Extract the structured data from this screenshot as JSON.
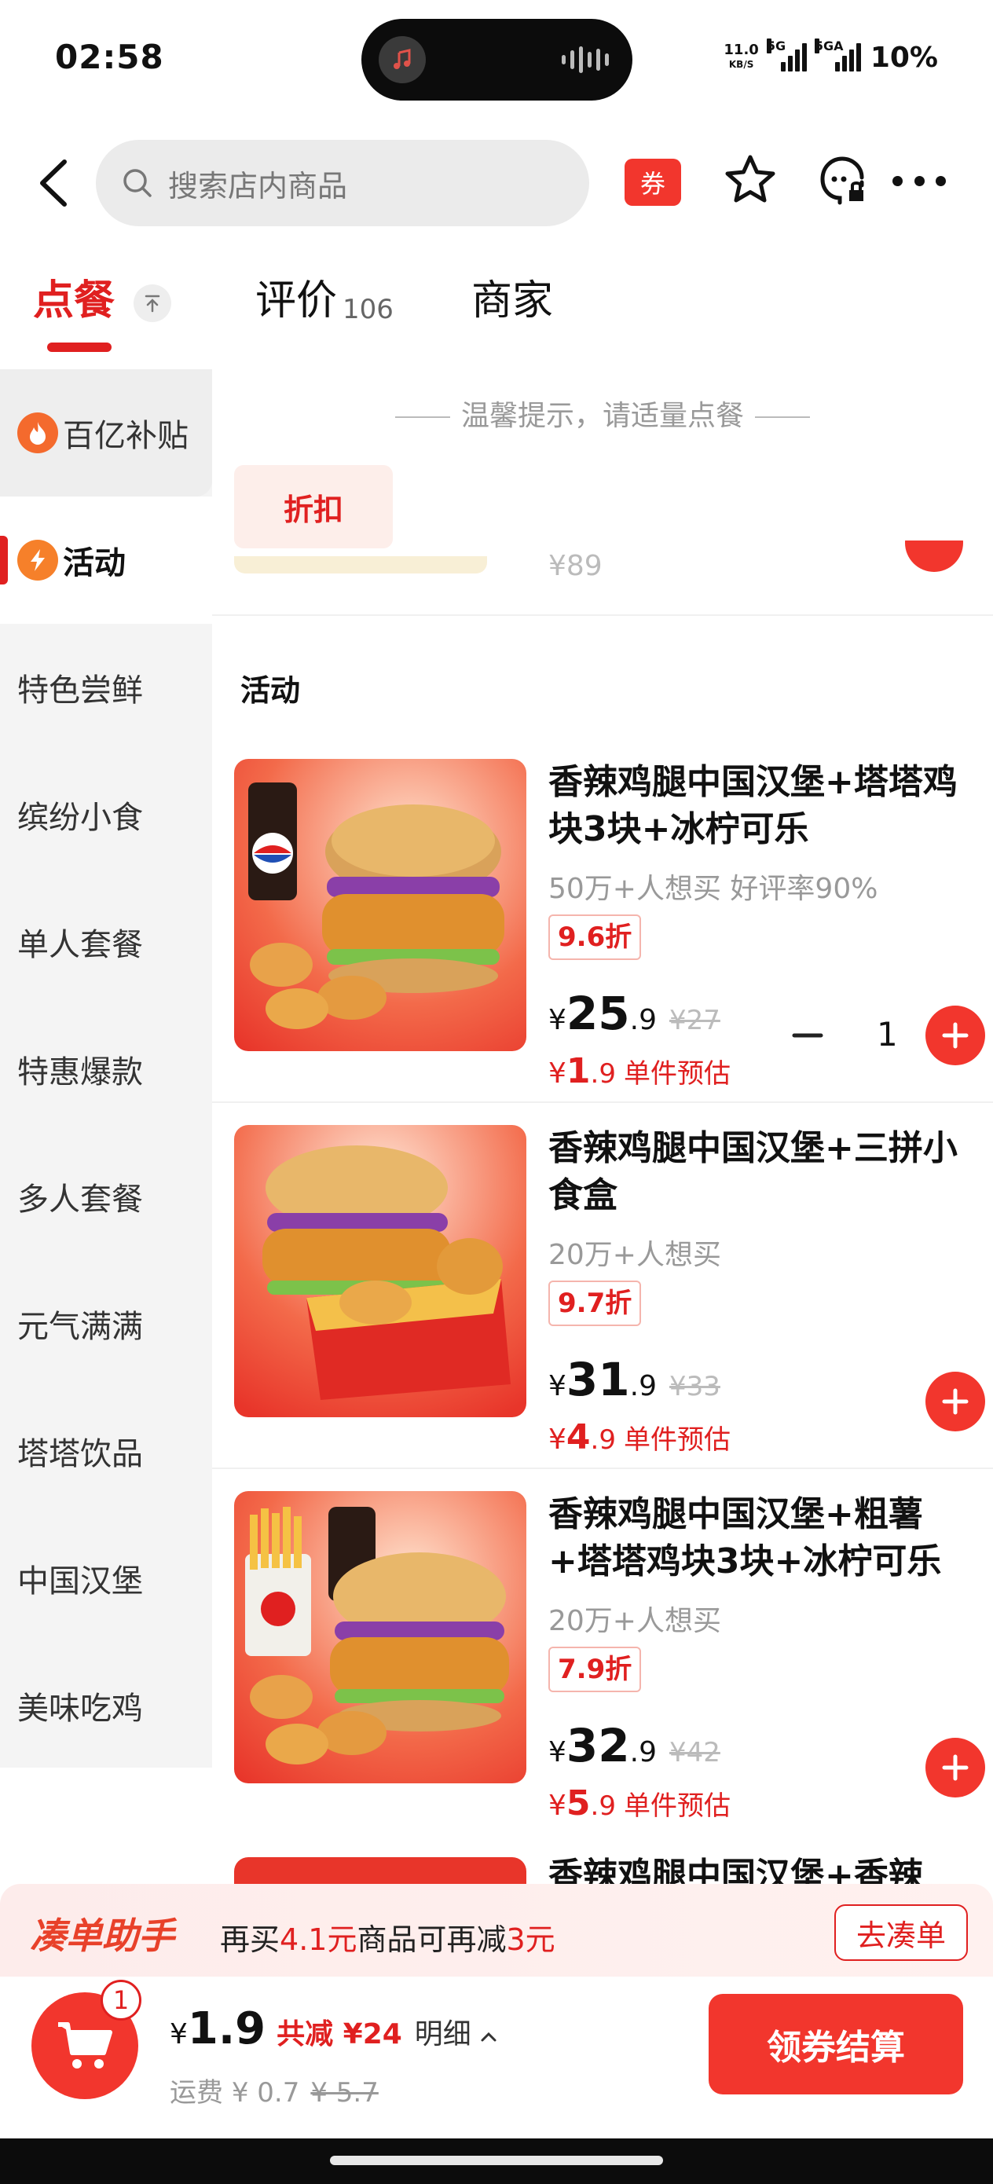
{
  "status_bar": {
    "time": "02:58",
    "net_speed_value": "11.0",
    "net_speed_unit": "KB/S",
    "signal1_label": "5G",
    "signal2_label": "5GA",
    "battery": "10%"
  },
  "header": {
    "search_placeholder": "搜索店内商品",
    "coupon_label": "券"
  },
  "tabs": {
    "order": "点餐",
    "review": "评价",
    "review_count": "106",
    "merchant": "商家"
  },
  "sidebar": {
    "items": [
      {
        "label": "百亿补贴",
        "icon": "flame-icon"
      },
      {
        "label": "活动",
        "icon": "lightning-icon"
      },
      {
        "label": "特色尝鲜"
      },
      {
        "label": "缤纷小食"
      },
      {
        "label": "单人套餐"
      },
      {
        "label": "特惠爆款"
      },
      {
        "label": "多人套餐"
      },
      {
        "label": "元气满满"
      },
      {
        "label": "塔塔饮品"
      },
      {
        "label": "中国汉堡"
      },
      {
        "label": "美味吃鸡"
      }
    ]
  },
  "content": {
    "notice": "温馨提示，请适量点餐",
    "discount_chip": "折扣",
    "prev_price": "¥89",
    "section_title": "活动",
    "products": [
      {
        "name": "香辣鸡腿中国汉堡+塔塔鸡块3块+冰柠可乐",
        "sales": "50万+人想买 好评率90%",
        "discount": "9.6折",
        "price_yen": "¥",
        "price_int": "25",
        "price_dec": ".9",
        "orig_price": "¥27",
        "est_yen": "¥",
        "est_int": "1",
        "est_dec": ".9",
        "est_label": "单件预估",
        "quantity": "1"
      },
      {
        "name": "香辣鸡腿中国汉堡+三拼小食盒",
        "sales": "20万+人想买",
        "discount": "9.7折",
        "price_yen": "¥",
        "price_int": "31",
        "price_dec": ".9",
        "orig_price": "¥33",
        "est_yen": "¥",
        "est_int": "4",
        "est_dec": ".9",
        "est_label": "单件预估"
      },
      {
        "name": "香辣鸡腿中国汉堡+粗薯+塔塔鸡块3块+冰柠可乐",
        "sales": "20万+人想买",
        "discount": "7.9折",
        "price_yen": "¥",
        "price_int": "32",
        "price_dec": ".9",
        "orig_price": "¥42",
        "est_yen": "¥",
        "est_int": "5",
        "est_dec": ".9",
        "est_label": "单件预估"
      },
      {
        "name": "香辣鸡腿中国汉堡+香辣"
      }
    ]
  },
  "helper_bar": {
    "title": "凑单助手",
    "text_prefix": "再买",
    "amount": "4.1元",
    "text_middle": "商品可再减",
    "reduce": "3元",
    "button": "去凑单"
  },
  "checkout": {
    "cart_count": "1",
    "yen": "¥",
    "total": "1.9",
    "saved": "共减 ¥24",
    "detail": "明细",
    "delivery_label": "运费",
    "delivery_fee": "¥ 0.7",
    "delivery_orig": "¥ 5.7",
    "button": "领券结算"
  },
  "colors": {
    "accent": "#f2362d",
    "accent_text": "#e02020",
    "sidebar_bg": "#f4f4f4"
  }
}
